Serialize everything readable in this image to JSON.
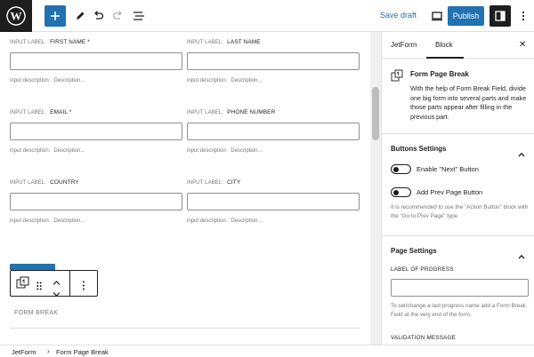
{
  "toolbar": {
    "save_draft": "Save draft",
    "publish": "Publish"
  },
  "form": {
    "label_prefix": "INPUT LABEL:",
    "desc_prefix": "input description:",
    "fields": [
      {
        "label": "FIRST NAME *",
        "description": "Description..."
      },
      {
        "label": "LAST NAME",
        "description": "Description..."
      },
      {
        "label": "EMAIL *",
        "description": "Description..."
      },
      {
        "label": "PHONE NUMBER",
        "description": "Description..."
      },
      {
        "label": "COUNTRY",
        "description": "Description..."
      },
      {
        "label": "CITY",
        "description": "Description..."
      }
    ],
    "form_break": "FORM BREAK"
  },
  "sidebar": {
    "tabs": [
      "JetForm",
      "Block"
    ],
    "active_tab": "Block",
    "block_title": "Form Page Break",
    "block_description": "With the help of Form Break Field, divide one big form into several parts and make those parts appear after filling in the previous part.",
    "buttons_settings": {
      "title": "Buttons Settings",
      "toggle_next": "Enable \"Next\" Button",
      "toggle_prev": "Add Prev Page Button",
      "help": "It is recommended to use the \"Action Button\" block with the \"Go to Prev Page\" type"
    },
    "page_settings": {
      "title": "Page Settings",
      "label_of_progress": "LABEL OF PROGRESS",
      "progress_help": "To set/change a last progress name add a Form Break Field at the very end of the form.",
      "validation_message": "VALIDATION MESSAGE"
    }
  },
  "breadcrumb": {
    "root": "JetForm",
    "current": "Form Page Break"
  },
  "colors": {
    "accent": "#2271b1",
    "dark": "#1e1e1e"
  }
}
